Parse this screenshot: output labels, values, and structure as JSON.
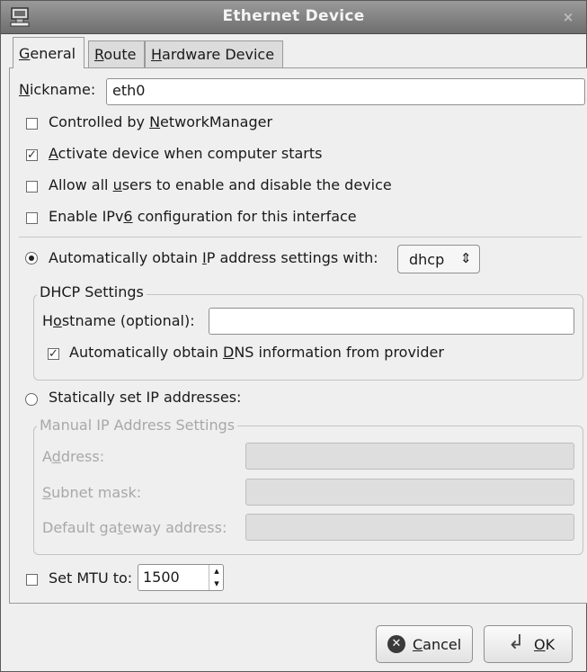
{
  "window": {
    "title": "Ethernet Device",
    "close_glyph": "×"
  },
  "tabs": [
    {
      "prefix": "",
      "mnemonic": "G",
      "rest": "eneral"
    },
    {
      "prefix": "",
      "mnemonic": "R",
      "rest": "oute"
    },
    {
      "prefix": "",
      "mnemonic": "H",
      "rest": "ardware Device"
    }
  ],
  "nickname": {
    "mnemonic": "N",
    "rest": "ickname:",
    "value": "eth0"
  },
  "options": {
    "controlled": {
      "prefix": "Controlled by ",
      "mnemonic": "N",
      "rest": "etworkManager",
      "checked": false,
      "check_glyph": ""
    },
    "activate": {
      "prefix": "",
      "mnemonic": "A",
      "rest": "ctivate device when computer starts",
      "checked": true,
      "check_glyph": "✓"
    },
    "allow_users": {
      "prefix": "Allow all ",
      "mnemonic": "u",
      "rest": "sers to enable and disable the device",
      "checked": false,
      "check_glyph": ""
    },
    "ipv6": {
      "prefix": "Enable IPv",
      "mnemonic": "6",
      "rest": " configuration for this interface",
      "checked": false,
      "check_glyph": ""
    }
  },
  "auto_ip": {
    "prefix": "Automatically obtain ",
    "mnemonic": "I",
    "rest": "P address settings with:",
    "selected": true,
    "method": "dhcp",
    "combo_glyph": "⇕"
  },
  "dhcp": {
    "title": "DHCP Settings",
    "hostname_prefix": "H",
    "hostname_mnemonic": "o",
    "hostname_rest": "stname (optional):",
    "hostname_value": "",
    "dns_prefix": "Automatically obtain ",
    "dns_mnemonic": "D",
    "dns_rest": "NS information from provider",
    "dns_checked": true,
    "dns_check_glyph": "✓"
  },
  "static_ip": {
    "label": "Statically set IP addresses:",
    "selected": false
  },
  "manual": {
    "title": "Manual IP Address Settings",
    "address": {
      "prefix": "A",
      "mnemonic": "d",
      "rest": "dress:",
      "value": ""
    },
    "subnet": {
      "prefix": "",
      "mnemonic": "S",
      "rest": "ubnet mask:",
      "value": ""
    },
    "gateway": {
      "prefix": "Default ga",
      "mnemonic": "t",
      "rest": "eway address:",
      "value": ""
    }
  },
  "mtu": {
    "label": "Set MTU to:",
    "value": "1500",
    "checked": false,
    "up_glyph": "▴",
    "down_glyph": "▾"
  },
  "buttons": {
    "cancel": {
      "mnemonic": "C",
      "rest": "ancel",
      "icon_glyph": "✕"
    },
    "ok": {
      "mnemonic": "O",
      "rest": "K",
      "icon_glyph": "↲"
    }
  },
  "colors": {
    "titlebar": "#7f7f7f",
    "window_bg": "#efefef"
  }
}
